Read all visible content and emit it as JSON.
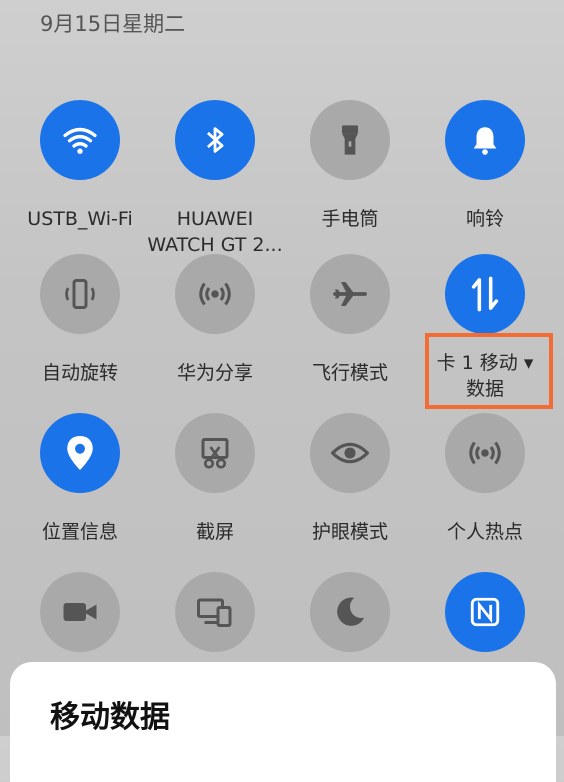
{
  "status": {
    "date": "9月15日星期二"
  },
  "tiles": [
    {
      "label": "USTB_Wi-Fi",
      "state": "on",
      "icon": "wifi-icon"
    },
    {
      "label": "HUAWEI\nWATCH GT 2...",
      "state": "on",
      "icon": "bluetooth-icon"
    },
    {
      "label": "手电筒",
      "state": "off",
      "icon": "flashlight-icon"
    },
    {
      "label": "响铃",
      "state": "on",
      "icon": "bell-icon"
    },
    {
      "label": "自动旋转",
      "state": "off",
      "icon": "auto-rotate-icon"
    },
    {
      "label": "华为分享",
      "state": "off",
      "icon": "huawei-share-icon"
    },
    {
      "label": "飞行模式",
      "state": "off",
      "icon": "airplane-icon"
    },
    {
      "label": "卡 1 移动 ▾\n数据",
      "state": "on",
      "icon": "mobile-data-icon"
    },
    {
      "label": "位置信息",
      "state": "on",
      "icon": "location-icon"
    },
    {
      "label": "截屏",
      "state": "off",
      "icon": "screenshot-icon"
    },
    {
      "label": "护眼模式",
      "state": "off",
      "icon": "eye-icon"
    },
    {
      "label": "个人热点",
      "state": "off",
      "icon": "hotspot-icon"
    },
    {
      "label": "",
      "state": "off",
      "icon": "video-camera-icon"
    },
    {
      "label": "",
      "state": "off",
      "icon": "multi-device-icon"
    },
    {
      "label": "",
      "state": "off",
      "icon": "moon-icon"
    },
    {
      "label": "",
      "state": "on",
      "icon": "nfc-icon"
    }
  ],
  "sheet": {
    "title": "移动数据"
  },
  "colors": {
    "active": "#1a73e8",
    "inactive": "#a9a9a9",
    "highlight": "#f26c34"
  }
}
